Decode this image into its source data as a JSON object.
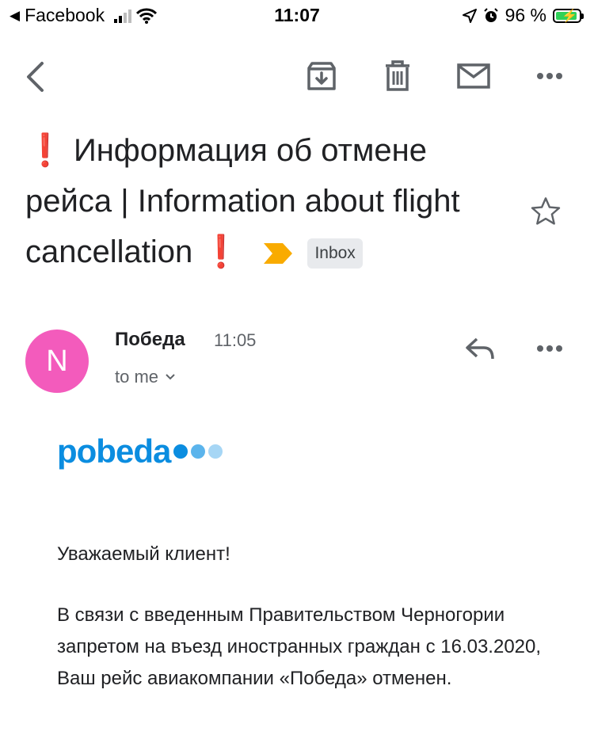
{
  "status_bar": {
    "back_app": "Facebook",
    "time": "11:07",
    "battery_percent": "96 %"
  },
  "toolbar": {
    "icons": [
      "back-arrow-icon",
      "archive-icon",
      "trash-icon",
      "mark-unread-icon",
      "more-icon"
    ]
  },
  "subject": {
    "text": "Информация об отмене рейса | Information about flight cancellation",
    "prefix_mark": "❗",
    "suffix_mark": "❗",
    "label": "Inbox",
    "importance_color": "#f9ab00"
  },
  "sender": {
    "avatar_letter": "N",
    "avatar_color": "#f35bbc",
    "name": "Победа",
    "time": "11:05",
    "recipient": "to me"
  },
  "body": {
    "logo_text": "pobeda",
    "logo_dot_colors": [
      "#0b8de0",
      "#5bb4ec",
      "#a6d6f5"
    ],
    "greeting": "Уважаемый клиент!",
    "paragraph": "В связи с введенным Правительством Черногории запретом на въезд иностранных граждан с 16.03.2020, Ваш рейс авиакомпании «Победа» отменен."
  }
}
